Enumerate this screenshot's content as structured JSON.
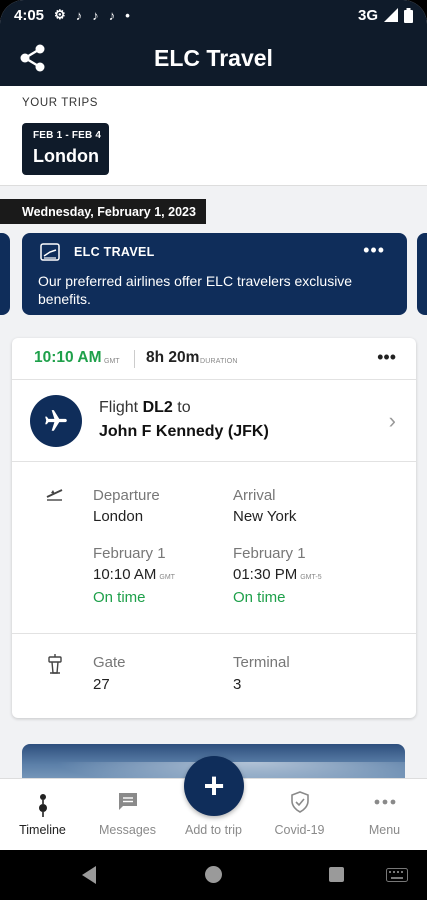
{
  "status_bar": {
    "time": "4:05",
    "network": "3G"
  },
  "app_bar": {
    "title": "ELC Travel"
  },
  "trips": {
    "label": "YOUR TRIPS",
    "items": [
      {
        "dates": "FEB 1 - FEB 4",
        "city": "London"
      }
    ]
  },
  "date_header": "Wednesday, February 1, 2023",
  "elc_card": {
    "brand": "ELC TRAVEL",
    "message": "Our preferred airlines offer ELC travelers exclusive benefits."
  },
  "flight": {
    "time": "10:10 AM",
    "time_zone": "GMT",
    "duration": "8h 20m",
    "duration_label": "DURATION",
    "flight_prefix": "Flight",
    "flight_number": "DL2",
    "flight_to": "to",
    "destination": "John F Kennedy (JFK)",
    "departure": {
      "label": "Departure",
      "city": "London",
      "date": "February 1",
      "time": "10:10 AM",
      "tz": "GMT",
      "status": "On time"
    },
    "arrival": {
      "label": "Arrival",
      "city": "New York",
      "date": "February 1",
      "time": "01:30 PM",
      "tz": "GMT-5",
      "status": "On time"
    },
    "gate": {
      "label": "Gate",
      "value": "27"
    },
    "terminal": {
      "label": "Terminal",
      "value": "3"
    }
  },
  "bottom_nav": {
    "items": [
      {
        "label": "Timeline",
        "icon": "timeline-icon",
        "active": true
      },
      {
        "label": "Messages",
        "icon": "messages-icon",
        "active": false
      },
      {
        "label": "Add to trip",
        "icon": "add-icon",
        "active": false
      },
      {
        "label": "Covid-19",
        "icon": "shield-icon",
        "active": false
      },
      {
        "label": "Menu",
        "icon": "more-icon",
        "active": false
      }
    ],
    "fab_symbol": "+"
  },
  "colors": {
    "header": "#0f1b2a",
    "navy": "#0f2d5a",
    "green": "#1ea04a",
    "background": "#f1f2f4"
  }
}
